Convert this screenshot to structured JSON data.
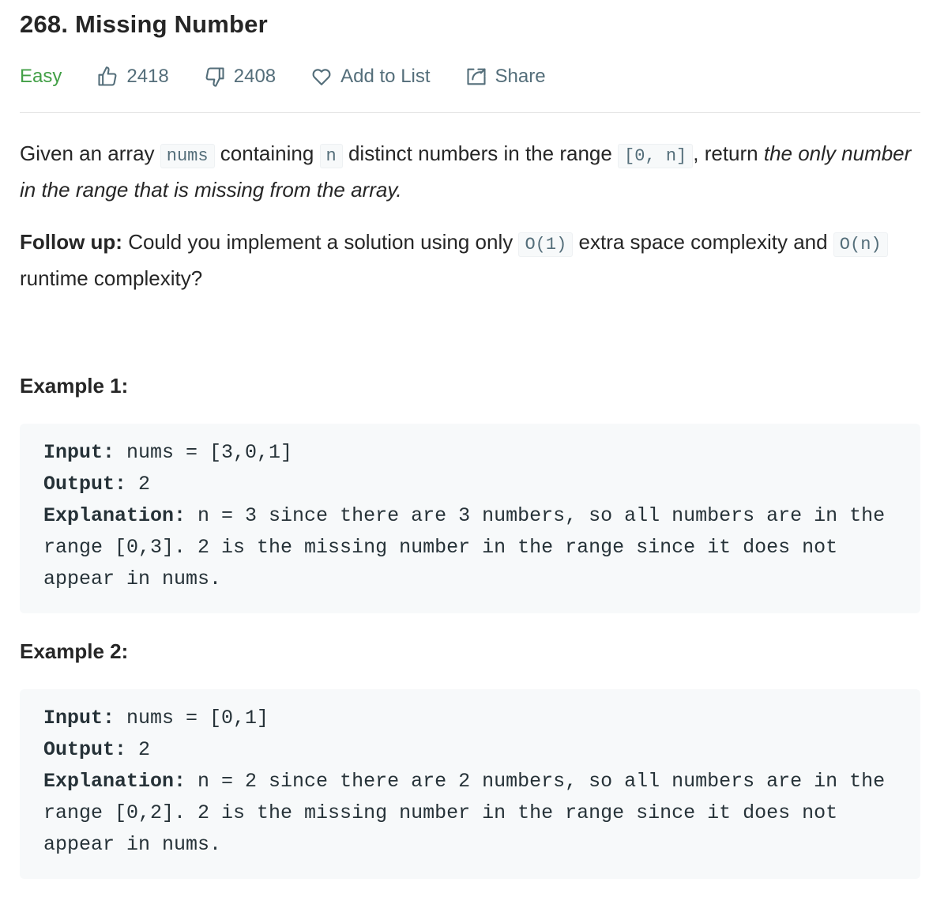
{
  "problem": {
    "title": "268. Missing Number"
  },
  "toolbar": {
    "difficulty": "Easy",
    "likes": "2418",
    "dislikes": "2408",
    "add_to_list": "Add to List",
    "share": "Share",
    "colors": {
      "difficulty": "#43a047",
      "icon": "#546e7a"
    },
    "icons": [
      "thumbs-up-icon",
      "thumbs-down-icon",
      "heart-icon",
      "share-icon"
    ]
  },
  "description": {
    "p1": {
      "t1": "Given an array ",
      "c1": "nums",
      "t2": " containing ",
      "c2": "n",
      "t3": " distinct numbers in the range ",
      "c3": "[0, n]",
      "t4": ", return ",
      "em": "the only number in the range that is missing from the array.",
      "t5": ""
    },
    "p2": {
      "strong": "Follow up:",
      "t1": " Could you implement a solution using only ",
      "c1": "O(1)",
      "t2": " extra space complexity and ",
      "c2": "O(n)",
      "t3": " runtime complexity?"
    }
  },
  "examples": [
    {
      "heading": "Example 1:",
      "input_label": "Input:",
      "input": " nums = [3,0,1]",
      "output_label": "Output:",
      "output": " 2",
      "explanation_label": "Explanation:",
      "explanation": " n = 3 since there are 3 numbers, so all numbers are in the range [0,3]. 2 is the missing number in the range since it does not appear in nums."
    },
    {
      "heading": "Example 2:",
      "input_label": "Input:",
      "input": " nums = [0,1]",
      "output_label": "Output:",
      "output": " 2",
      "explanation_label": "Explanation:",
      "explanation": " n = 2 since there are 2 numbers, so all numbers are in the range [0,2]. 2 is the missing number in the range since it does not appear in nums."
    }
  ]
}
